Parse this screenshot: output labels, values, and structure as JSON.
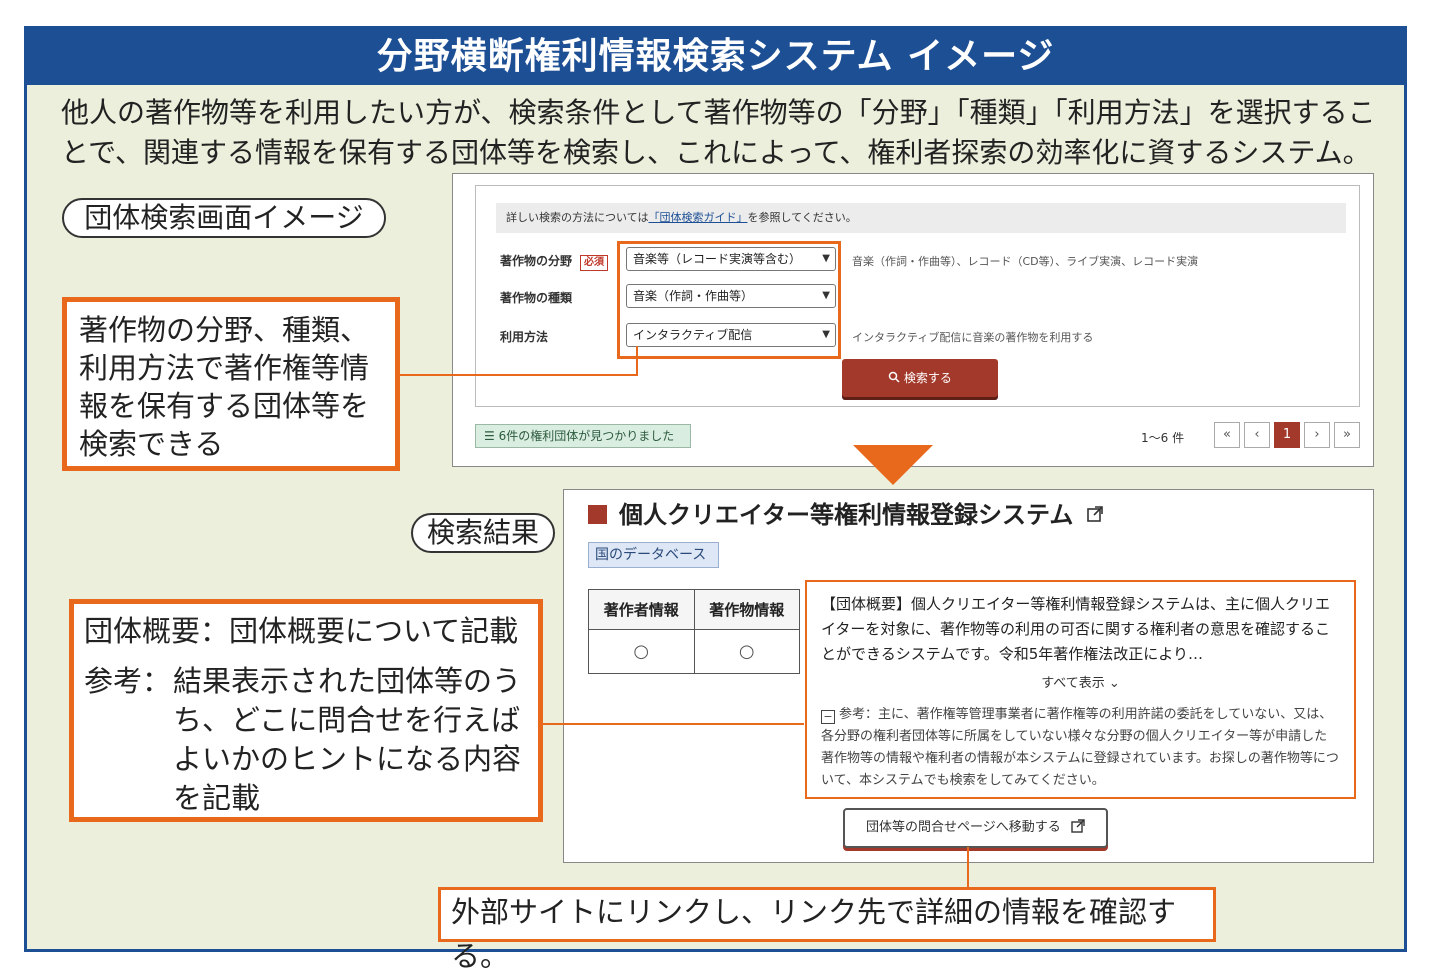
{
  "title": "分野横断権利情報検索システム イメージ",
  "intro": "他人の著作物等を利用したい方が、検索条件として著作物等の「分野」「種類」「利用方法」を選択することで、関連する情報を保有する団体等を検索し、これによって、権利者探索の効率化に資するシステム。",
  "labels": {
    "search_screen": "団体検索画面イメージ",
    "result": "検索結果"
  },
  "callouts": {
    "search": "著作物の分野、種類、利用方法で著作権等情報を保有する団体等を検索できる",
    "summary_line": "団体概要：団体概要について記載",
    "ref_label": "参考：",
    "ref_text": "結果表示された団体等のうち、どこに問合せを行えばよいかのヒントになる内容を記載",
    "link": "外部サイトにリンクし、リンク先で詳細の情報を確認する。"
  },
  "search_panel": {
    "guide_prefix": "詳しい検索の方法については",
    "guide_link": "「団体検索ガイド」",
    "guide_suffix": "を参照してください。",
    "field1_label": "著作物の分野",
    "required": "必須",
    "field1_value": "音楽等（レコード実演等含む）",
    "field1_hint": "音楽（作詞・作曲等）、レコード（CD等）、ライブ実演、レコード実演",
    "field2_label": "著作物の種類",
    "field2_value": "音楽（作詞・作曲等）",
    "field3_label": "利用方法",
    "field3_value": "インタラクティブ配信",
    "field3_hint": "インタラクティブ配信に音楽の著作物を利用する",
    "search_button": "検索する",
    "found_text": "6件の権利団体が見つかりました",
    "count_text": "1〜6 件",
    "pager": {
      "first": "«",
      "prev": "‹",
      "current": "1",
      "next": "›",
      "last": "»"
    },
    "search_icon": "search-icon",
    "filter_icon": "filter-icon"
  },
  "result_panel": {
    "title": "個人クリエイター等権利情報登録システム",
    "external_icon": "external-link-icon",
    "db_badge": "国のデータベース",
    "table_headers": [
      "著作者情報",
      "著作物情報"
    ],
    "table_values": [
      "○",
      "○"
    ],
    "summary": "【団体概要】個人クリエイター等権利情報登録システムは、主に個人クリエイターを対象に、著作物等の利用の可否に関する権利者の意思を確認することができるシステムです。令和5年著作権法改正により…",
    "show_all": "すべて表示",
    "note": "参考：主に、著作権等管理事業者に著作権等の利用許諾の委託をしていない、又は、各分野の権利者団体等に所属をしていない様々な分野の個人クリエイター等が申請した著作物等の情報や権利者の情報が本システムに登録されています。お探しの著作物等について、本システムでも検索をしてみてください。",
    "move_button": "団体等の問合せページへ移動する"
  },
  "colors": {
    "frame": "#1d4f95",
    "background": "#ecefdc",
    "accent": "#e8691c",
    "button": "#a3392b"
  }
}
